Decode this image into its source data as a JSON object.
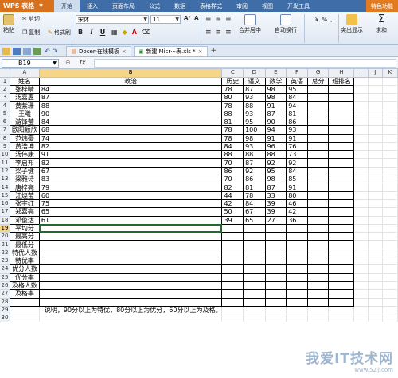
{
  "menubar": {
    "logo": "WPS 表格",
    "menus": [
      "开始",
      "插入",
      "页面布局",
      "公式",
      "数据",
      "表格样式",
      "审阅",
      "视图",
      "开发工具"
    ],
    "active_index": 0,
    "special": "特色功能"
  },
  "ribbon": {
    "paste": "粘贴",
    "cut": "剪切",
    "copy": "复制",
    "format_painter": "格式刷",
    "font_name": "宋体",
    "font_size": "11",
    "bold": "B",
    "italic": "I",
    "underline": "U",
    "merge_center": "合并居中",
    "auto_wrap": "自动换行",
    "highlight_dup": "突出显示",
    "sum": "求和"
  },
  "tabs": [
    {
      "label": "Docer-在线模板",
      "active": false
    },
    {
      "label": "新建 Micr···表.xls *",
      "active": true
    }
  ],
  "formula_bar": {
    "name_box": "B19",
    "fx": "fx",
    "content": ""
  },
  "sheet": {
    "columns": [
      "A",
      "B",
      "C",
      "D",
      "E",
      "F",
      "G",
      "H",
      "I",
      "J",
      "K"
    ],
    "selected_column": "B",
    "selected_row": 19,
    "rows": [
      [
        "姓名",
        "政治",
        "历史",
        "语文",
        "数学",
        "英语",
        "总分",
        "班排名"
      ],
      [
        "张梓晴",
        "84",
        "78",
        "87",
        "98",
        "95",
        "",
        ""
      ],
      [
        "汤嘉惠",
        "87",
        "80",
        "93",
        "98",
        "84",
        "",
        ""
      ],
      [
        "黄紫珊",
        "88",
        "78",
        "88",
        "91",
        "94",
        "",
        ""
      ],
      [
        "王曦",
        "90",
        "88",
        "93",
        "87",
        "81",
        "",
        ""
      ],
      [
        "游锋莹",
        "84",
        "81",
        "95",
        "90",
        "86",
        "",
        ""
      ],
      [
        "欧阳颖欣",
        "68",
        "78",
        "100",
        "94",
        "93",
        "",
        ""
      ],
      [
        "范炜豪",
        "74",
        "78",
        "98",
        "91",
        "91",
        "",
        ""
      ],
      [
        "黄浩坤",
        "82",
        "84",
        "93",
        "96",
        "76",
        "",
        ""
      ],
      [
        "汤伟康",
        "91",
        "88",
        "88",
        "88",
        "73",
        "",
        ""
      ],
      [
        "李启邦",
        "82",
        "70",
        "87",
        "92",
        "92",
        "",
        ""
      ],
      [
        "梁子健",
        "67",
        "86",
        "92",
        "95",
        "84",
        "",
        ""
      ],
      [
        "梁雅诗",
        "83",
        "70",
        "86",
        "98",
        "85",
        "",
        ""
      ],
      [
        "唐梓亮",
        "79",
        "82",
        "81",
        "87",
        "91",
        "",
        ""
      ],
      [
        "江烧莹",
        "60",
        "44",
        "78",
        "33",
        "80",
        "",
        ""
      ],
      [
        "张宇红",
        "75",
        "42",
        "84",
        "39",
        "46",
        "",
        ""
      ],
      [
        "郑嘉亮",
        "65",
        "50",
        "67",
        "39",
        "42",
        "",
        ""
      ],
      [
        "邓俊达",
        "61",
        "39",
        "65",
        "27",
        "36",
        "",
        ""
      ],
      [
        "平均分",
        "",
        "",
        "",
        "",
        "",
        "",
        ""
      ],
      [
        "最高分",
        "",
        "",
        "",
        "",
        "",
        "",
        ""
      ],
      [
        "最低分",
        "",
        "",
        "",
        "",
        "",
        "",
        ""
      ],
      [
        "特优人数",
        "",
        "",
        "",
        "",
        "",
        "",
        ""
      ],
      [
        "特优率",
        "",
        "",
        "",
        "",
        "",
        "",
        ""
      ],
      [
        "优分人数",
        "",
        "",
        "",
        "",
        "",
        "",
        ""
      ],
      [
        "优分率",
        "",
        "",
        "",
        "",
        "",
        "",
        ""
      ],
      [
        "及格人数",
        "",
        "",
        "",
        "",
        "",
        "",
        ""
      ],
      [
        "及格率",
        "",
        "",
        "",
        "",
        "",
        "",
        ""
      ],
      [
        "",
        "",
        "",
        "",
        "",
        "",
        "",
        ""
      ]
    ],
    "note_row": 29,
    "note": "说明，90分以上为特优，80分以上为优分，60分以上为及格。",
    "last_row": 30
  },
  "watermark": {
    "title": "我爱IT技术网",
    "url": "www.52ij.com"
  },
  "colors": {
    "menubar": "#3e6da8",
    "logo": "#d9701c",
    "selection": "#1e6b2d",
    "header_highlight": "#f6d488"
  }
}
